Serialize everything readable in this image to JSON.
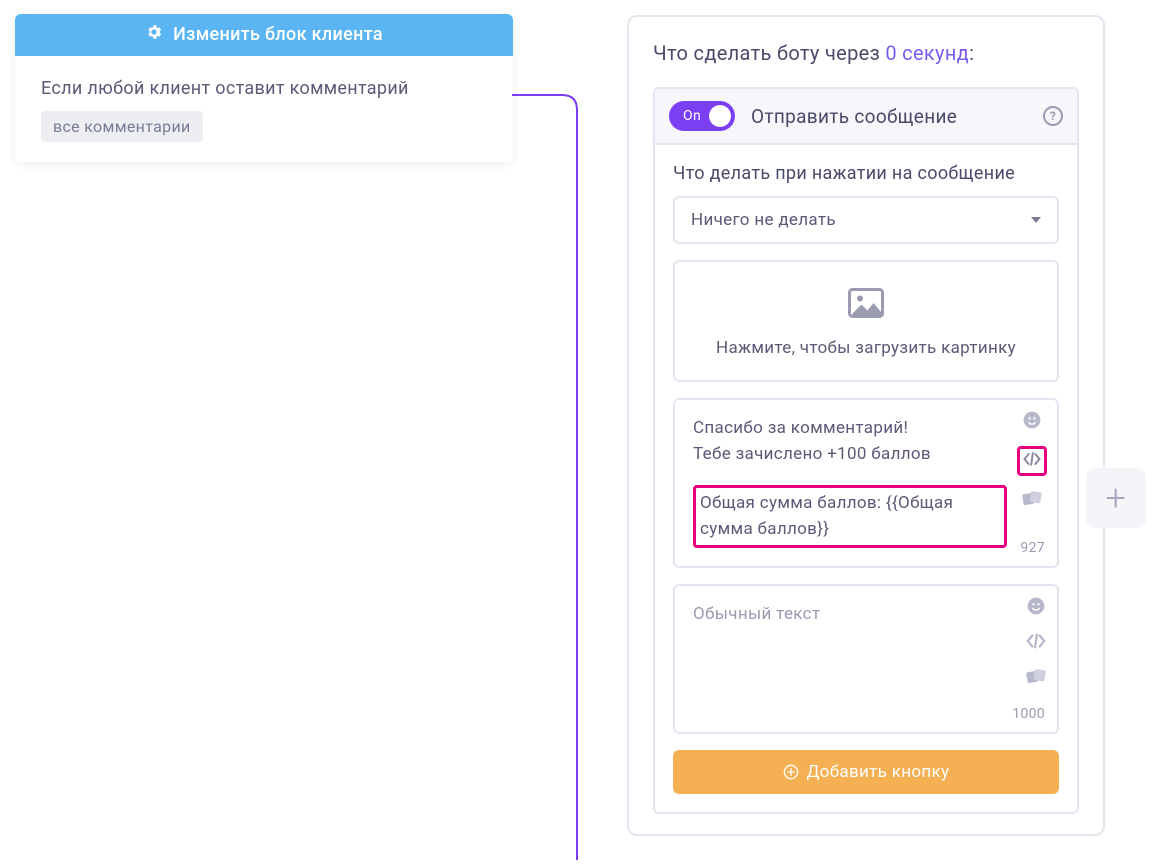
{
  "left": {
    "header": "Изменить блок клиента",
    "body_text": "Если любой клиент оставит комментарий",
    "tag": "все комментарии"
  },
  "right": {
    "title_prefix": "Что сделать боту через ",
    "seconds": "0 секунд",
    "title_suffix": ":",
    "toggle_label": "On",
    "action_title": "Отправить сообщение",
    "sub_label": "Что делать при нажатии на сообщение",
    "select_value": "Ничего не делать",
    "upload_text": "Нажмите, чтобы загрузить картинку",
    "msg1_line1": "Спасибо за комментарий!",
    "msg1_line2": "Тебе зачислено +100 баллов",
    "msg1_highlight": "Общая сумма баллов:  {{Общая сумма баллов}}",
    "msg1_count": "927",
    "msg2_placeholder": "Обычный текст",
    "msg2_count": "1000",
    "add_button": "Добавить кнопку"
  }
}
